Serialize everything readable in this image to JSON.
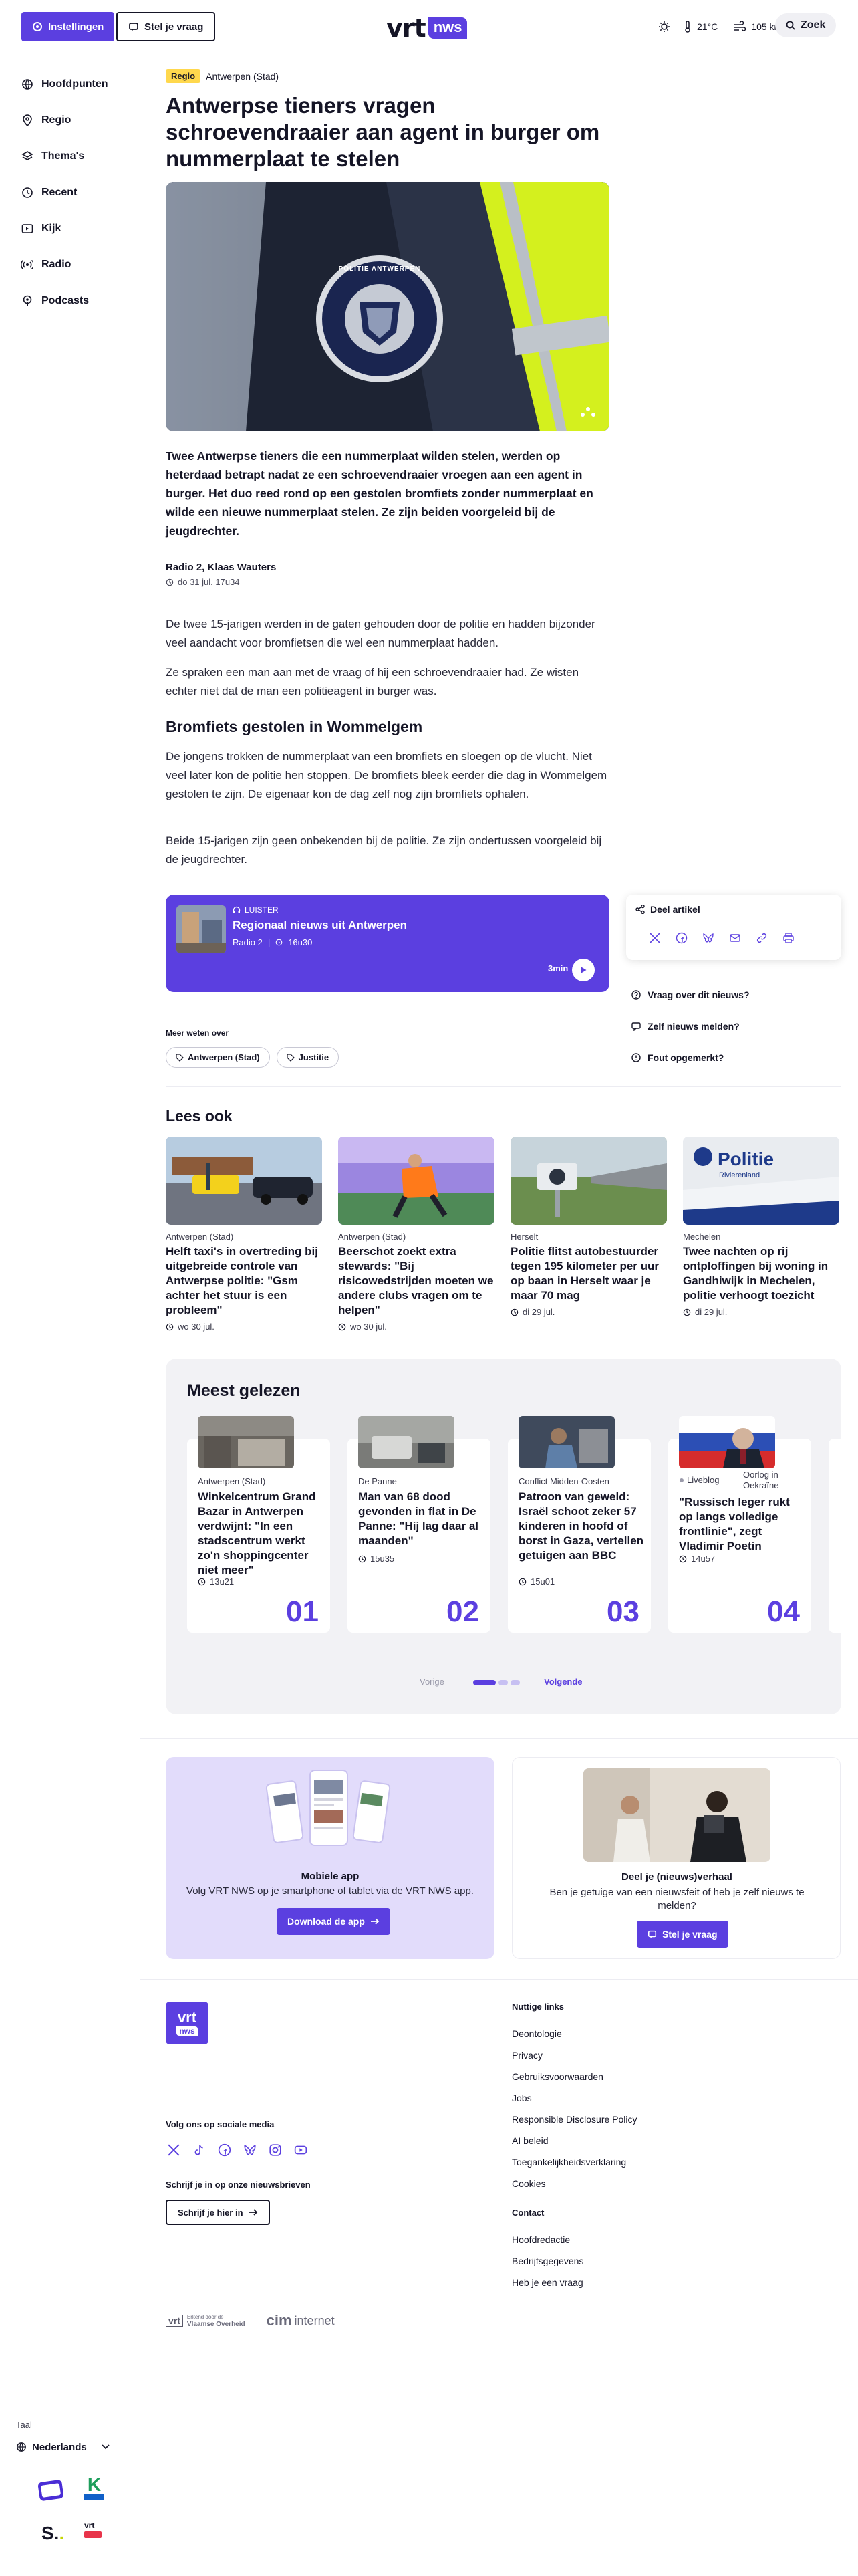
{
  "header": {
    "settings_label": "Instellingen",
    "question_label": "Stel je vraag",
    "logo_vrt": "vrt",
    "logo_nws": "nws",
    "temperature": "21°C",
    "wind": "105 km",
    "search_label": "Zoek"
  },
  "sidebar": {
    "items": [
      {
        "label": "Hoofdpunten",
        "icon": "globe-icon"
      },
      {
        "label": "Regio",
        "icon": "location-pin-icon"
      },
      {
        "label": "Thema's",
        "icon": "layers-icon"
      },
      {
        "label": "Recent",
        "icon": "clock-icon"
      },
      {
        "label": "Kijk",
        "icon": "play-icon"
      },
      {
        "label": "Radio",
        "icon": "radio-icon"
      },
      {
        "label": "Podcasts",
        "icon": "podcast-icon"
      }
    ]
  },
  "article": {
    "tag": "Regio",
    "location": "Antwerpen (Stad)",
    "title": "Antwerpse tieners vragen schroevendraaier aan agent in burger om nummerplaat te stelen",
    "lead": "Twee Antwerpse tieners die een nummerplaat wilden stelen, werden op heterdaad betrapt nadat ze een schroevendraaier vroegen aan een agent in burger. Het duo reed rond op een gestolen bromfiets zonder nummerplaat en wilde een nieuwe nummerplaat stelen. Ze zijn beiden voorgeleid bij de jeugdrechter.",
    "authors": "Radio 2, Klaas Wauters",
    "date": "do 31 jul. 17u34",
    "p1": "De twee 15-jarigen werden in de gaten gehouden door de politie en hadden bijzonder veel aandacht voor bromfietsen die wel een nummerplaat hadden.",
    "p2": "Ze spraken een man aan met de vraag of hij een schroevendraaier had. Ze wisten echter niet dat de man een politieagent in burger was.",
    "subheading": "Bromfiets gestolen in Wommelgem",
    "p3": "De jongens trokken de nummerplaat van een bromfiets en sloegen op de vlucht. Niet veel later kon de politie hen stoppen. De bromfiets bleek eerder die dag in Wommelgem gestolen te zijn. De eigenaar kon de dag zelf nog zijn bromfiets ophalen.",
    "p4": "Beide 15-jarigen zijn geen onbekenden bij de politie. Ze zijn ondertussen voorgeleid bij de jeugdrechter.",
    "badge_text": "POLITIE ANTWERPEN"
  },
  "listen": {
    "kicker": "LUISTER",
    "title": "Regionaal nieuws uit Antwerpen",
    "station": "Radio 2",
    "time": "16u30",
    "duration": "3min"
  },
  "share": {
    "title": "Deel artikel",
    "links": [
      "Vraag over dit nieuws?",
      "Zelf nieuws melden?",
      "Fout opgemerkt?"
    ]
  },
  "more": {
    "label": "Meer weten over",
    "tags": [
      "Antwerpen (Stad)",
      "Justitie"
    ]
  },
  "lees_ook": {
    "heading": "Lees ook",
    "items": [
      {
        "meta": "Antwerpen (Stad)",
        "title": "Helft taxi's in overtreding bij uitgebreide controle van Antwerpse politie: \"Gsm achter het stuur is een probleem\"",
        "date": "wo 30 jul."
      },
      {
        "meta": "Antwerpen (Stad)",
        "title": "Beerschot zoekt extra stewards: \"Bij risicowedstrijden moeten we andere clubs vragen om te helpen\"",
        "date": "wo 30 jul."
      },
      {
        "meta": "Herselt",
        "title": "Politie flitst autobestuurder tegen 195 kilometer per uur op baan in Herselt waar je maar 70 mag",
        "date": "di 29 jul."
      },
      {
        "meta": "Mechelen",
        "title": "Twee nachten op rij ontploffingen bij woning in Gandhiwijk in Mechelen, politie verhoogt toezicht",
        "date": "di 29 jul.",
        "img_text": "Politie",
        "img_sub": "Rivierenland"
      }
    ]
  },
  "meest_gelezen": {
    "heading": "Meest gelezen",
    "items": [
      {
        "meta": "Antwerpen (Stad)",
        "title": "Winkelcentrum Grand Bazar in Antwerpen verdwijnt: \"In een stadscentrum werkt zo'n shoppingcenter niet meer\"",
        "time": "13u21",
        "num": "01"
      },
      {
        "meta": "De Panne",
        "title": "Man van 68 dood gevonden in flat in De Panne: \"Hij lag daar al maanden\"",
        "time": "15u35",
        "num": "02"
      },
      {
        "meta": "Conflict Midden-Oosten",
        "title": "Patroon van geweld: Israël schoot zeker 57 kinderen in hoofd of borst in Gaza, vertellen getuigen aan BBC",
        "time": "15u01",
        "num": "03"
      },
      {
        "meta_live": "Liveblog",
        "meta": "Oorlog in Oekraïne",
        "title": "\"Russisch leger rukt op langs volledige frontlinie\", zegt Vladimir Poetin",
        "time": "14u57",
        "num": "04"
      }
    ],
    "prev": "Vorige",
    "next": "Volgende"
  },
  "promo": {
    "app_title": "Mobiele app",
    "app_text": "Volg VRT NWS op je smartphone of tablet via de VRT NWS app.",
    "app_button": "Download de app",
    "share_title": "Deel je (nieuws)verhaal",
    "share_text": "Ben je getuige van een nieuwsfeit of heb je zelf nieuws te melden?",
    "share_button": "Stel je vraag"
  },
  "footer": {
    "social_title": "Volg ons op sociale media",
    "newsletter_title": "Schrijf je in op onze nieuwsbrieven",
    "newsletter_button": "Schrijf je hier in",
    "links_title": "Nuttige links",
    "links": [
      "Deontologie",
      "Privacy",
      "Gebruiksvoorwaarden",
      "Jobs",
      "Responsible Disclosure Policy",
      "AI beleid",
      "Toegankelijkheidsverklaring",
      "Cookies"
    ],
    "contact_title": "Contact",
    "contact_links": [
      "Hoofdredactie",
      "Bedrijfsgegevens",
      "Heb je een vraag"
    ],
    "partner1_small": "Erkend door de",
    "partner1": "Vlaamse Overheid",
    "partner2": "internet",
    "taal_label": "Taal",
    "taal_value": "Nederlands",
    "sponsor_k": "K",
    "sponsor_s": "S."
  },
  "colors": {
    "accent": "#5b3fe0",
    "tag_yellow": "#ffd84d",
    "text": "#151526"
  }
}
